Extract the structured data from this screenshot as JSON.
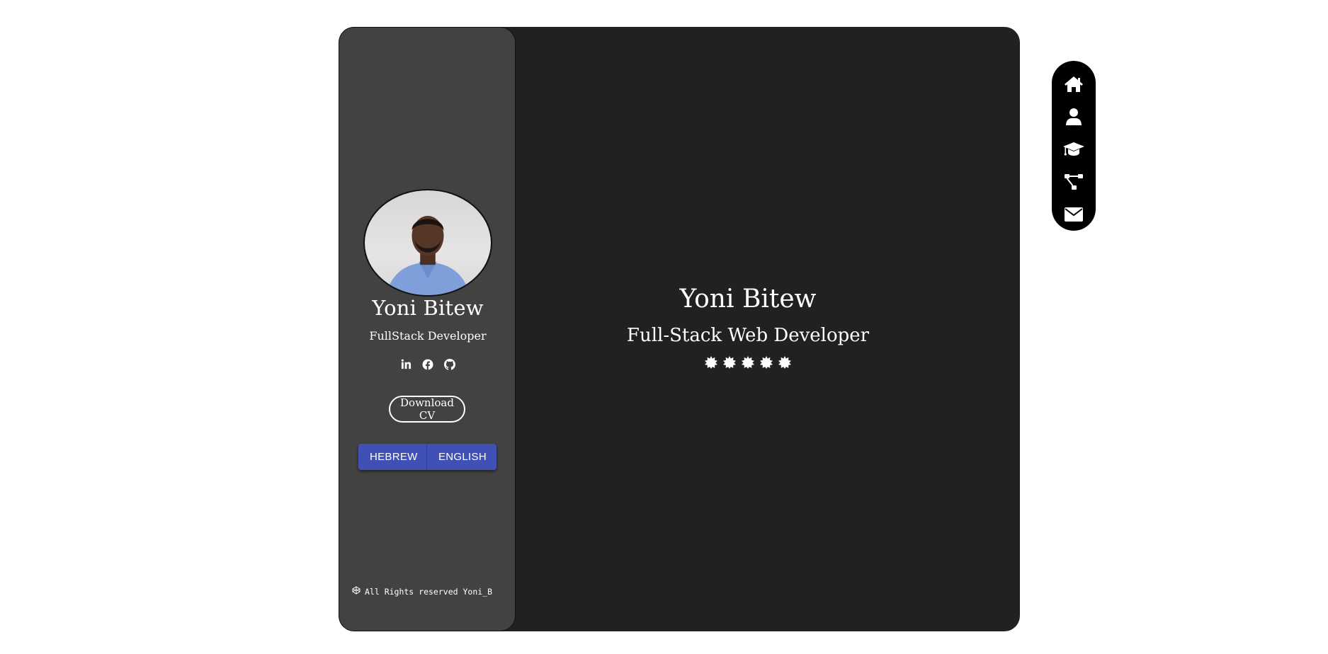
{
  "sidebar": {
    "name": "Yoni Bitew",
    "role": "FullStack Developer",
    "socials": [
      {
        "icon": "linkedin-icon"
      },
      {
        "icon": "facebook-icon"
      },
      {
        "icon": "github-icon"
      }
    ],
    "download_label": "Download CV",
    "languages": [
      "HEBREW",
      "ENGLISH"
    ],
    "footer_text": "All Rights reserved Yoni_B"
  },
  "hero": {
    "name": "Yoni Bitew",
    "role": "Full-Stack Web Developer",
    "stars": 5
  },
  "nav": {
    "items": [
      {
        "icon": "home-icon"
      },
      {
        "icon": "user-icon"
      },
      {
        "icon": "graduation-cap-icon"
      },
      {
        "icon": "project-diagram-icon"
      },
      {
        "icon": "envelope-icon"
      }
    ]
  },
  "colors": {
    "card_bg": "#212121",
    "sidebar_bg": "#424242",
    "button_primary": "#3f51b5",
    "nav_bg": "#000000"
  }
}
